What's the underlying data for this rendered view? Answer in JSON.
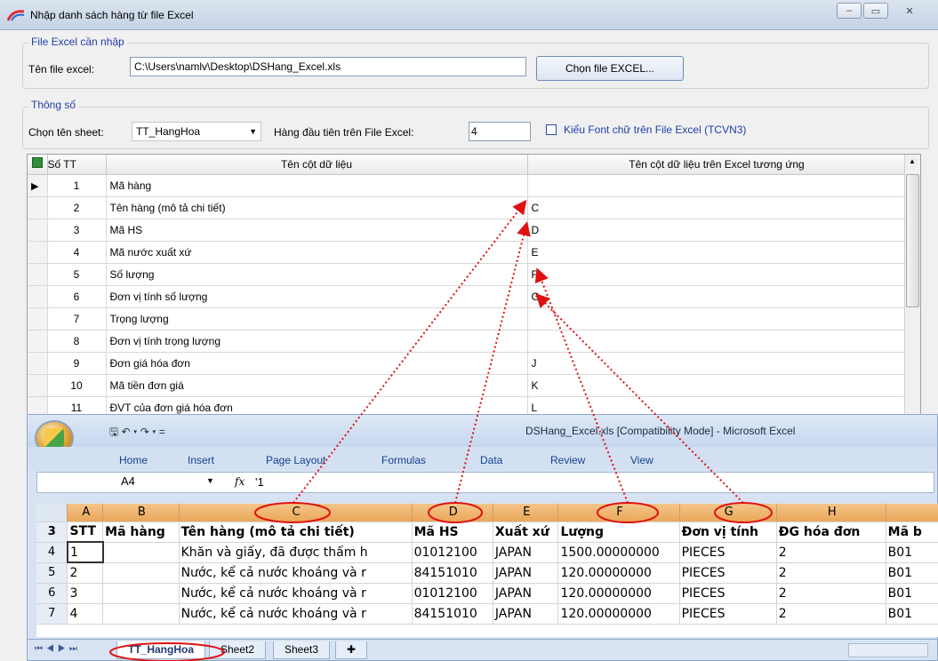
{
  "window": {
    "title": "Nhập danh sách hàng từ file Excel",
    "btn_min": "–",
    "btn_max": "▭",
    "btn_close": "✕"
  },
  "file_group": {
    "title": "File Excel cần nhập",
    "file_label": "Tên file excel:",
    "file_value": "C:\\Users\\namlv\\Desktop\\DSHang_Excel.xls",
    "choose_button": "Chọn file EXCEL..."
  },
  "params_group": {
    "title": "Thông số",
    "sheet_label": "Chọn tên sheet:",
    "sheet_value": "TT_HangHoa",
    "first_row_label": "Hàng đầu tiên trên File Excel:",
    "first_row_value": "4",
    "font_checkbox_label": "Kiểu Font chữ trên File Excel (TCVN3)"
  },
  "grid": {
    "headers": [
      "Số TT",
      "Tên cột dữ liệu",
      "Tên cột dữ liệu trên Excel tương ứng"
    ],
    "rows": [
      {
        "stt": "1",
        "name": "Mã hàng",
        "col": ""
      },
      {
        "stt": "2",
        "name": "Tên hàng (mô tả chi tiết)",
        "col": "C"
      },
      {
        "stt": "3",
        "name": "Mã HS",
        "col": "D"
      },
      {
        "stt": "4",
        "name": "Mã nước xuất xứ",
        "col": "E"
      },
      {
        "stt": "5",
        "name": "Số lượng",
        "col": "F"
      },
      {
        "stt": "6",
        "name": "Đơn vị tính số lượng",
        "col": "G"
      },
      {
        "stt": "7",
        "name": "Trọng lượng",
        "col": ""
      },
      {
        "stt": "8",
        "name": "Đơn vị tính trọng lượng",
        "col": ""
      },
      {
        "stt": "9",
        "name": "Đơn giá hóa đơn",
        "col": "J"
      },
      {
        "stt": "10",
        "name": "Mã tiền đơn giá",
        "col": "K"
      },
      {
        "stt": "11",
        "name": "ĐVT của đơn giá hóa đơn",
        "col": "L"
      }
    ]
  },
  "excel": {
    "caption": "DSHang_Excel.xls  [Compatibility Mode] - Microsoft Excel",
    "qat": "🖫 ↶ ▾ ↷ ▾  =",
    "tabs": [
      "Home",
      "Insert",
      "Page Layout",
      "Formulas",
      "Data",
      "Review",
      "View"
    ],
    "name_box": "A4",
    "fx": "fx",
    "formula_value": "'1",
    "col_headers": [
      "A",
      "B",
      "C",
      "D",
      "E",
      "F",
      "G",
      "H",
      ""
    ],
    "rows": [
      {
        "rn": "3",
        "cells": [
          "STT",
          "Mã hàng",
          "Tên hàng (mô tả chi tiết)",
          "Mã HS",
          "Xuất xứ",
          "Lượng",
          "Đơn vị tính",
          "ĐG hóa đơn",
          "Mã b"
        ]
      },
      {
        "rn": "4",
        "cells": [
          "1",
          "",
          "Khăn và giấy, đã được thấm h",
          "01012100",
          "JAPAN",
          "1500.00000000",
          "PIECES",
          "2",
          "B01"
        ]
      },
      {
        "rn": "5",
        "cells": [
          "2",
          "",
          "Nước, kể cả nước khoáng và r",
          "84151010",
          "JAPAN",
          "120.00000000",
          "PIECES",
          "2",
          "B01"
        ]
      },
      {
        "rn": "6",
        "cells": [
          "3",
          "",
          "Nước, kể cả nước khoáng và r",
          "01012100",
          "JAPAN",
          "120.00000000",
          "PIECES",
          "2",
          "B01"
        ]
      },
      {
        "rn": "7",
        "cells": [
          "4",
          "",
          "Nước, kể cả nước khoáng và r",
          "84151010",
          "JAPAN",
          "120.00000000",
          "PIECES",
          "2",
          "B01"
        ]
      }
    ],
    "sheet_tabs": [
      "TT_HangHoa",
      "Sheet2",
      "Sheet3"
    ]
  }
}
